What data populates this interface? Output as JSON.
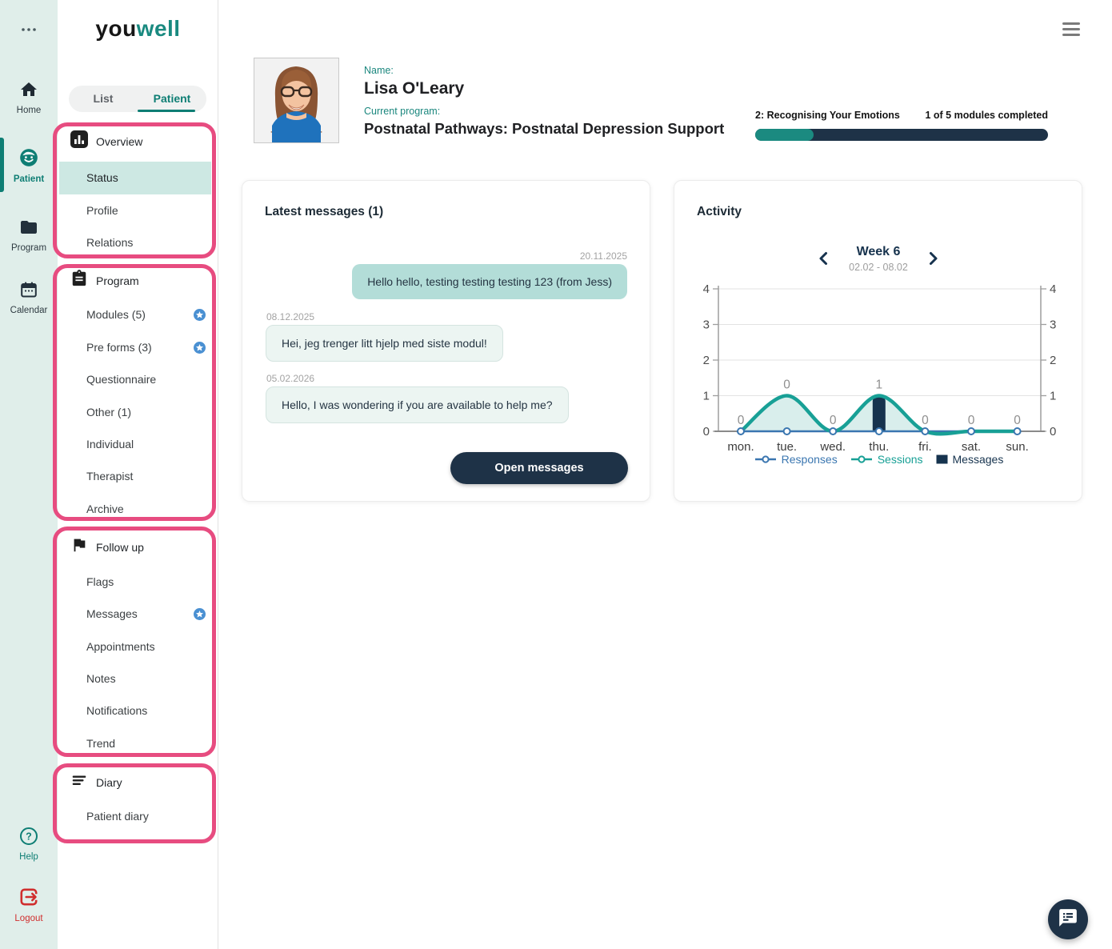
{
  "brand": {
    "logo_part1": "you",
    "logo_part2": "well"
  },
  "rail": {
    "items": [
      {
        "label": "Home",
        "icon": "home-icon",
        "active": false
      },
      {
        "label": "Patient",
        "icon": "patient-icon",
        "active": true
      },
      {
        "label": "Program",
        "icon": "folder-icon",
        "active": false
      },
      {
        "label": "Calendar",
        "icon": "calendar-icon",
        "active": false
      }
    ],
    "help_label": "Help",
    "logout_label": "Logout"
  },
  "sidebar": {
    "tabs": {
      "list": "List",
      "patient": "Patient"
    },
    "sections": [
      {
        "title": "Overview",
        "icon": "bar-chart-icon",
        "items": [
          {
            "label": "Status",
            "active": true
          },
          {
            "label": "Profile"
          },
          {
            "label": "Relations"
          }
        ]
      },
      {
        "title": "Program",
        "icon": "clipboard-icon",
        "items": [
          {
            "label": "Modules (5)",
            "badge": true
          },
          {
            "label": "Pre forms (3)",
            "badge": true
          },
          {
            "label": "Questionnaire"
          },
          {
            "label": "Other (1)"
          },
          {
            "label": "Individual"
          },
          {
            "label": "Therapist"
          },
          {
            "label": "Archive"
          }
        ]
      },
      {
        "title": "Follow up",
        "icon": "flag-icon",
        "items": [
          {
            "label": "Flags"
          },
          {
            "label": "Messages",
            "badge": true
          },
          {
            "label": "Appointments"
          },
          {
            "label": "Notes"
          },
          {
            "label": "Notifications"
          },
          {
            "label": "Trend"
          }
        ]
      },
      {
        "title": "Diary",
        "icon": "lines-icon",
        "items": [
          {
            "label": "Patient diary"
          }
        ]
      }
    ]
  },
  "patient": {
    "name_label": "Name:",
    "name": "Lisa O'Leary",
    "program_label": "Current program:",
    "program": "Postnatal Pathways: Postnatal Depression Support",
    "module_progress_label": "2: Recognising Your Emotions",
    "modules_completed_label": "1 of 5 modules completed",
    "progress_percent": 20
  },
  "messages": {
    "title": "Latest messages (1)",
    "items": [
      {
        "date": "20.11.2025",
        "text": "Hello hello, testing testing testing 123 (from Jess)",
        "direction": "outgoing"
      },
      {
        "date": "08.12.2025",
        "text": "Hei, jeg trenger litt hjelp med siste modul!",
        "direction": "incoming"
      },
      {
        "date": "05.02.2026",
        "text": "Hello, I was wondering if you are available to help me?",
        "direction": "incoming"
      }
    ],
    "open_button_label": "Open messages"
  },
  "activity": {
    "title": "Activity",
    "week_label": "Week 6",
    "date_range": "02.02 - 08.02"
  },
  "chart_data": {
    "type": "line",
    "title": "Activity — Week 6 (02.02 - 08.02)",
    "categories": [
      "mon.",
      "tue.",
      "wed.",
      "thu.",
      "fri.",
      "sat.",
      "sun."
    ],
    "series": [
      {
        "name": "Responses",
        "kind": "line",
        "color": "#3a76b0",
        "values": [
          0,
          0,
          0,
          0,
          0,
          0,
          0
        ]
      },
      {
        "name": "Sessions",
        "kind": "spline-area",
        "color": "#18a096",
        "fill": "#d9eeec",
        "values": [
          0,
          1,
          0,
          1,
          0,
          0,
          0
        ]
      },
      {
        "name": "Messages",
        "kind": "bar",
        "color": "#16334e",
        "values": [
          0,
          0,
          0,
          1,
          0,
          0,
          0
        ]
      }
    ],
    "point_labels": [
      "0",
      "0",
      "0",
      "1",
      "0",
      "0",
      "0"
    ],
    "ylim": [
      0,
      4
    ],
    "yticks": [
      0,
      1,
      2,
      3,
      4
    ],
    "grid": true,
    "legend_position": "bottom"
  },
  "colors": {
    "accent_teal": "#0e7e74",
    "dark_navy": "#1e3247",
    "annotation_pink": "#e74c80",
    "rail_bg": "#e0eeea",
    "active_item_bg": "#cde8e3",
    "logout_red": "#d02e2e",
    "badge_blue": "#4a90d2"
  }
}
